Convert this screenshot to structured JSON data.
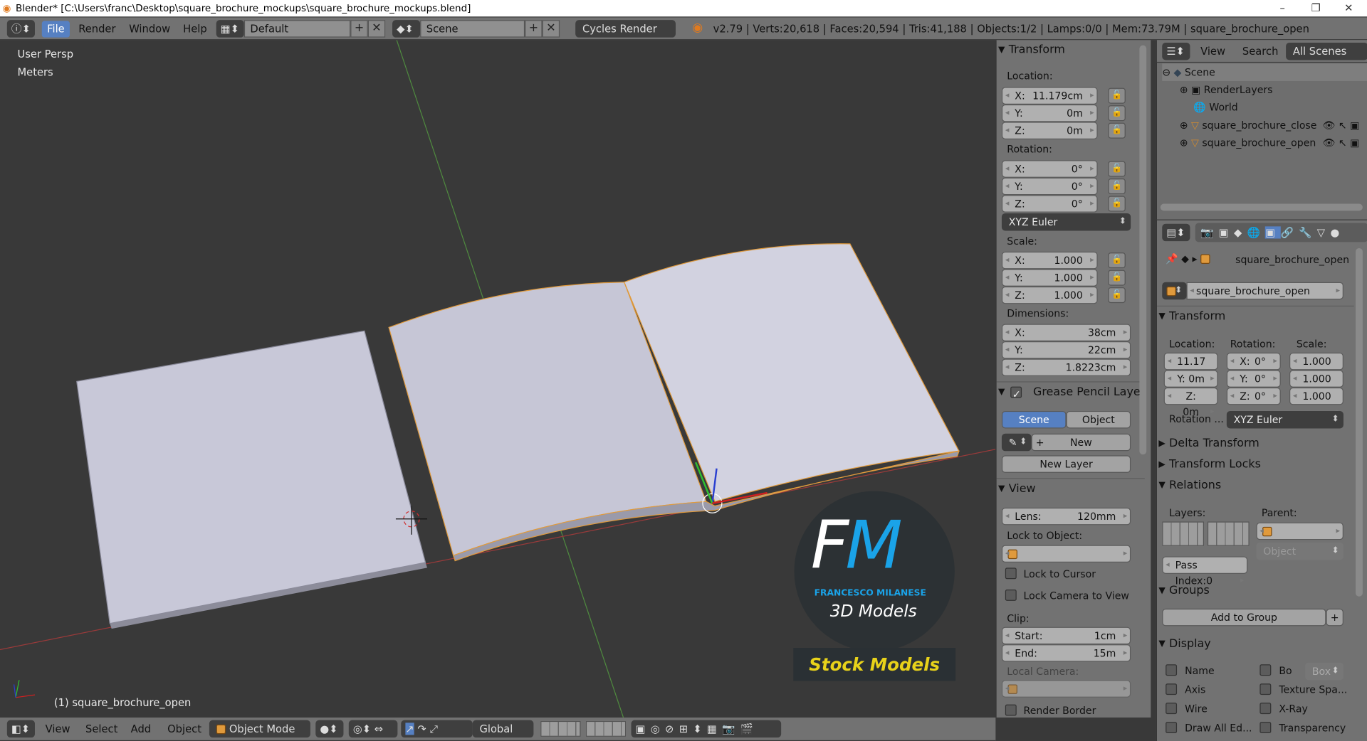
{
  "window": {
    "title": "Blender* [C:\\Users\\franc\\Desktop\\square_brochure_mockups\\square_brochure_mockups.blend]",
    "controls": {
      "minimize": "–",
      "maximize": "❐",
      "close": "✕"
    }
  },
  "topbar": {
    "menus": [
      "File",
      "Render",
      "Window",
      "Help"
    ],
    "layout": "Default",
    "scene": "Scene",
    "engine": "Cycles Render",
    "stats": "v2.79 | Verts:20,618 | Faces:20,594 | Tris:41,188 | Objects:1/2 | Lamps:0/0 | Mem:73.79M | square_brochure_open"
  },
  "viewport": {
    "view_name": "User Persp",
    "units": "Meters",
    "active_object": "(1) square_brochure_open",
    "watermark": {
      "logo": "FM",
      "author": "FRANCESCO MILANESE",
      "subtitle": "3D Models",
      "tag": "Stock Models"
    }
  },
  "npanel": {
    "transform": {
      "title": "Transform",
      "location_label": "Location:",
      "location": [
        {
          "k": "X:",
          "v": "11.179cm"
        },
        {
          "k": "Y:",
          "v": "0m"
        },
        {
          "k": "Z:",
          "v": "0m"
        }
      ],
      "rotation_label": "Rotation:",
      "rotation": [
        {
          "k": "X:",
          "v": "0°"
        },
        {
          "k": "Y:",
          "v": "0°"
        },
        {
          "k": "Z:",
          "v": "0°"
        }
      ],
      "rotation_mode": "XYZ Euler",
      "scale_label": "Scale:",
      "scale": [
        {
          "k": "X:",
          "v": "1.000"
        },
        {
          "k": "Y:",
          "v": "1.000"
        },
        {
          "k": "Z:",
          "v": "1.000"
        }
      ],
      "dimensions_label": "Dimensions:",
      "dimensions": [
        {
          "k": "X:",
          "v": "38cm"
        },
        {
          "k": "Y:",
          "v": "22cm"
        },
        {
          "k": "Z:",
          "v": "1.8223cm"
        }
      ]
    },
    "grease_pencil": {
      "title": "Grease Pencil Layer",
      "tabs": [
        "Scene",
        "Object"
      ],
      "new": "New",
      "new_layer": "New Layer"
    },
    "view": {
      "title": "View",
      "lens_k": "Lens:",
      "lens_v": "120mm",
      "lock_to_object": "Lock to Object:",
      "lock_to_cursor": "Lock to Cursor",
      "lock_camera": "Lock Camera to View",
      "clip": "Clip:",
      "start_k": "Start:",
      "start_v": "1cm",
      "end_k": "End:",
      "end_v": "15m",
      "local_camera": "Local Camera:",
      "render_border": "Render Border"
    }
  },
  "outliner": {
    "menus": [
      "View",
      "Search"
    ],
    "filter": "All Scenes",
    "items": [
      {
        "label": "Scene"
      },
      {
        "label": "RenderLayers"
      },
      {
        "label": "World"
      },
      {
        "label": "square_brochure_close"
      },
      {
        "label": "square_brochure_open"
      }
    ]
  },
  "properties": {
    "object_name": "square_brochure_open",
    "breadcrumb": "square_brochure_open",
    "transform": {
      "title": "Transform",
      "location": "Location:",
      "rotation": "Rotation:",
      "scale": "Scale:",
      "loc": [
        "11.17",
        "Y: 0m",
        "Z: 0m"
      ],
      "rot": [
        {
          "k": "X:",
          "v": "0°"
        },
        {
          "k": "Y:",
          "v": "0°"
        },
        {
          "k": "Z:",
          "v": "0°"
        }
      ],
      "scl": [
        "1.000",
        "1.000",
        "1.000"
      ],
      "rotation_mode_label": "Rotation ...",
      "rotation_mode": "XYZ Euler"
    },
    "delta": "Delta Transform",
    "locks": "Transform Locks",
    "relations": {
      "title": "Relations",
      "layers": "Layers:",
      "parent": "Parent:",
      "parent_type": "Object",
      "pass_index": "Pass Index:0"
    },
    "groups": {
      "title": "Groups",
      "add": "Add to Group"
    },
    "display": {
      "title": "Display",
      "left": [
        "Name",
        "Axis",
        "Wire",
        "Draw All Ed..."
      ],
      "right": [
        "Bo",
        "Texture Spa...",
        "X-Ray",
        "Transparency"
      ],
      "bounds": "Box"
    }
  },
  "viewbar": {
    "menus": [
      "View",
      "Select",
      "Add",
      "Object"
    ],
    "mode": "Object Mode",
    "orientation": "Global"
  },
  "colors": {
    "accent": "#5680c2",
    "viewport": "#393939",
    "panel": "#727272",
    "watermark_blue": "#1aa3e8",
    "watermark_yellow": "#e8d21a"
  }
}
